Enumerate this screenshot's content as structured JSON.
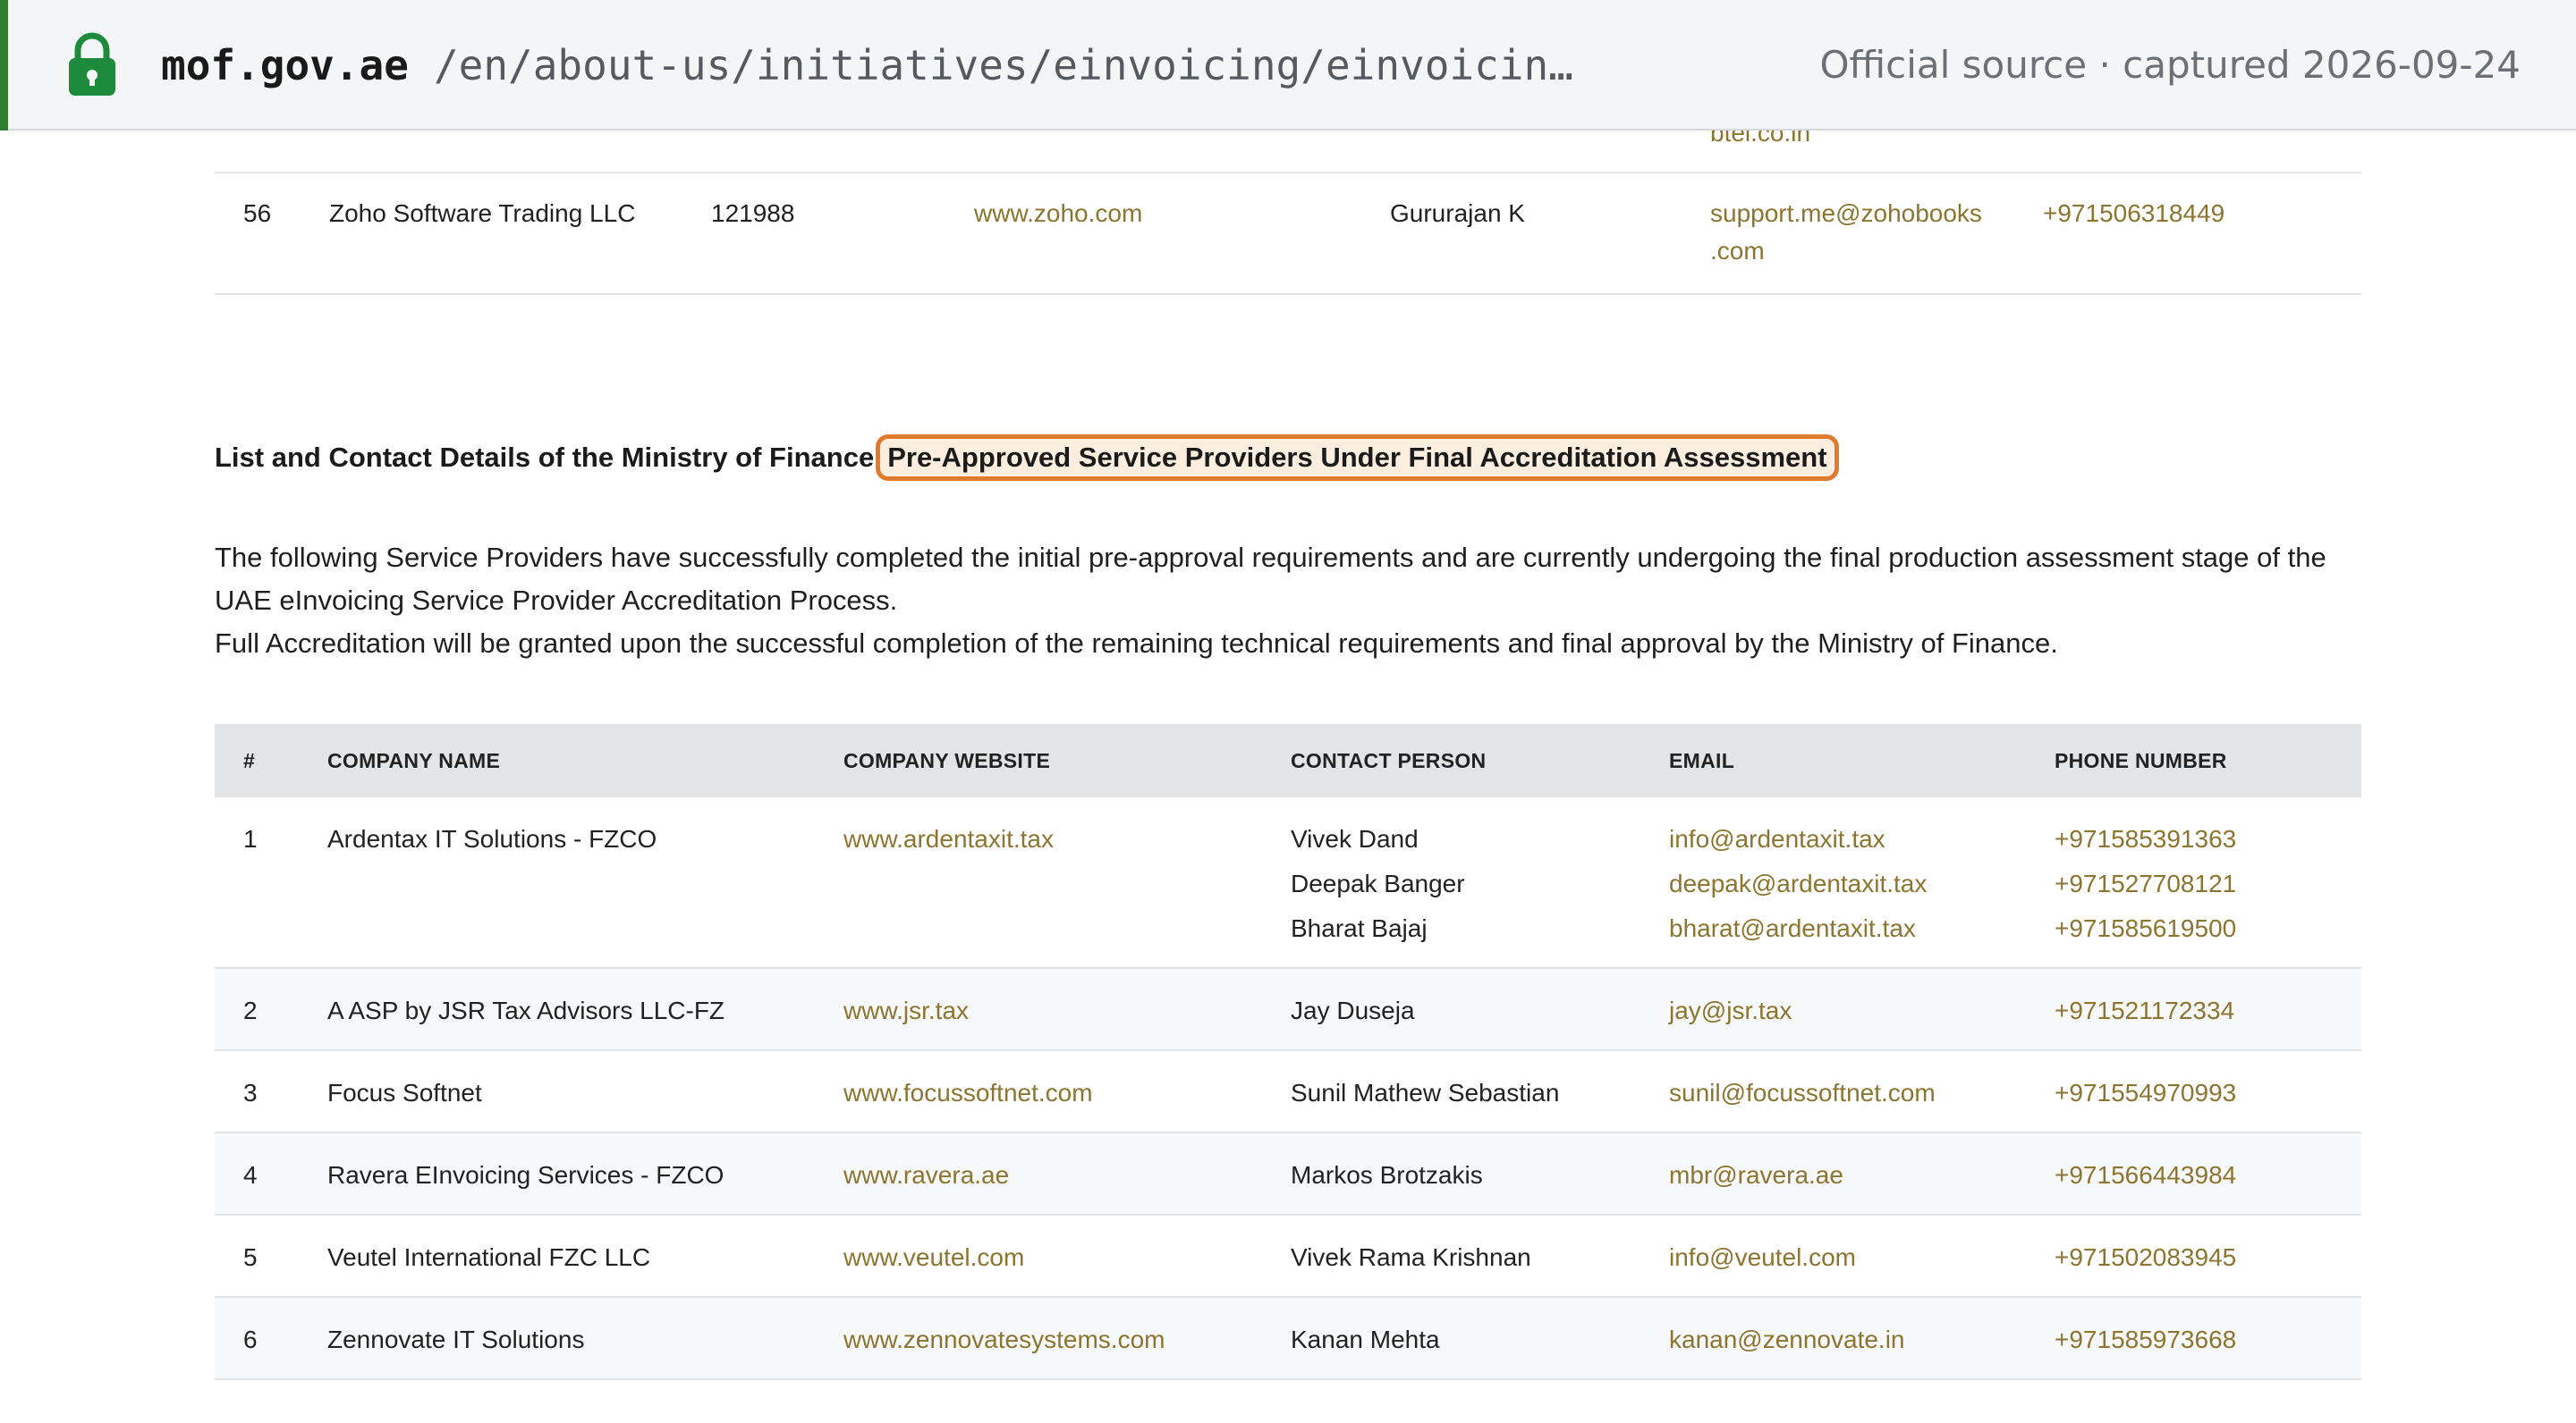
{
  "source_bar": {
    "domain": "mof.gov.ae",
    "path": "/en/about-us/initiatives/einvoicing/einvoicin…",
    "captured": "Official source · captured 2026-09-24",
    "icon": "lock-icon"
  },
  "top_table": {
    "partial_email": "btel.co.in",
    "row_56": {
      "num": "56",
      "company": "Zoho Software Trading LLC",
      "id": "121988",
      "website": "www.zoho.com",
      "contact": "Gururajan K",
      "email_line1": "support.me@zohobooks",
      "email_line2": ".com",
      "phone": "+971506318449"
    }
  },
  "section": {
    "heading_prefix": "List and Contact Details of the Ministry of Finance",
    "heading_highlight": "Pre-Approved Service Providers Under Final Accreditation Assessment",
    "intro_line1": "The following Service Providers have successfully completed the initial pre-approval requirements and are currently undergoing the final production assessment stage of the UAE eInvoicing Service Provider Accreditation Process.",
    "intro_line2": "Full Accreditation will be granted upon the successful completion of the remaining technical requirements and final approval by the Ministry of Finance."
  },
  "table": {
    "headers": {
      "num": "#",
      "company": "COMPANY NAME",
      "website": "COMPANY WEBSITE",
      "contact": "CONTACT PERSON",
      "email": "EMAIL",
      "phone": "PHONE NUMBER"
    },
    "rows": [
      {
        "num": "1",
        "company": "Ardentax IT Solutions - FZCO",
        "website": "www.ardentaxit.tax",
        "contacts": [
          "Vivek Dand",
          "Deepak Banger",
          "Bharat Bajaj"
        ],
        "emails": [
          "info@ardentaxit.tax",
          "deepak@ardentaxit.tax",
          "bharat@ardentaxit.tax"
        ],
        "phones": [
          "+971585391363",
          "+971527708121",
          "+971585619500"
        ]
      },
      {
        "num": "2",
        "company": "A ASP by JSR Tax Advisors LLC-FZ",
        "website": "www.jsr.tax",
        "contacts": [
          "Jay Duseja"
        ],
        "emails": [
          "jay@jsr.tax"
        ],
        "phones": [
          "+971521172334"
        ]
      },
      {
        "num": "3",
        "company": "Focus Softnet",
        "website": "www.focussoftnet.com",
        "contacts": [
          "Sunil Mathew Sebastian"
        ],
        "emails": [
          "sunil@focussoftnet.com"
        ],
        "phones": [
          "+971554970993"
        ]
      },
      {
        "num": "4",
        "company": "Ravera EInvoicing Services - FZCO",
        "website": "www.ravera.ae",
        "contacts": [
          "Markos Brotzakis"
        ],
        "emails": [
          "mbr@ravera.ae"
        ],
        "phones": [
          "+971566443984"
        ]
      },
      {
        "num": "5",
        "company": "Veutel International FZC LLC",
        "website": "www.veutel.com",
        "contacts": [
          "Vivek Rama Krishnan"
        ],
        "emails": [
          "info@veutel.com"
        ],
        "phones": [
          "+971502083945"
        ]
      },
      {
        "num": "6",
        "company": "Zennovate IT Solutions",
        "website": "www.zennovatesystems.com",
        "contacts": [
          "Kanan Mehta"
        ],
        "emails": [
          "kanan@zennovate.in"
        ],
        "phones": [
          "+971585973668"
        ]
      }
    ]
  },
  "colors": {
    "link": "#8c7530",
    "highlight_border": "#e07b2e",
    "source_accent": "#2e7d32"
  }
}
